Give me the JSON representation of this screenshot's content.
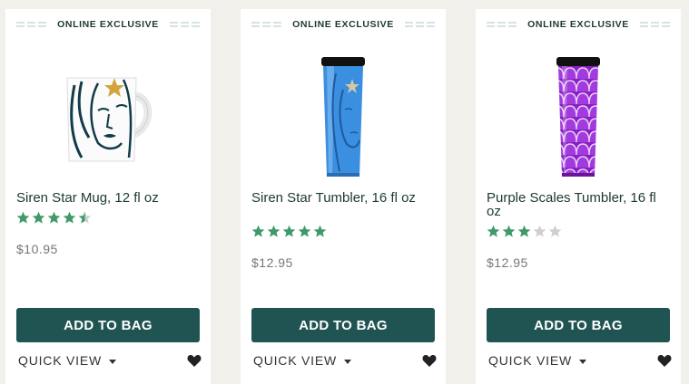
{
  "colors": {
    "brand_green": "#1f5452",
    "star_green": "#3f9a6b",
    "star_grey": "#cfcfcf",
    "text_dark": "#1e3932"
  },
  "products": [
    {
      "badge": "ONLINE EXCLUSIVE",
      "name": "Siren Star Mug, 12 fl oz",
      "rating": 4.5,
      "price": "$10.95",
      "button": "ADD TO BAG",
      "quick_view": "QUICK VIEW",
      "icons": [
        "mug-image",
        "heart-icon"
      ]
    },
    {
      "badge": "ONLINE EXCLUSIVE",
      "name": "Siren Star Tumbler, 16 fl oz",
      "rating": 5,
      "price": "$12.95",
      "button": "ADD TO BAG",
      "quick_view": "QUICK VIEW",
      "icons": [
        "tumbler-image",
        "heart-icon"
      ]
    },
    {
      "badge": "ONLINE EXCLUSIVE",
      "name": "Purple Scales Tumbler, 16 fl oz",
      "rating": 3,
      "price": "$12.95",
      "button": "ADD TO BAG",
      "quick_view": "QUICK VIEW",
      "icons": [
        "tumbler-image",
        "heart-icon"
      ]
    }
  ]
}
